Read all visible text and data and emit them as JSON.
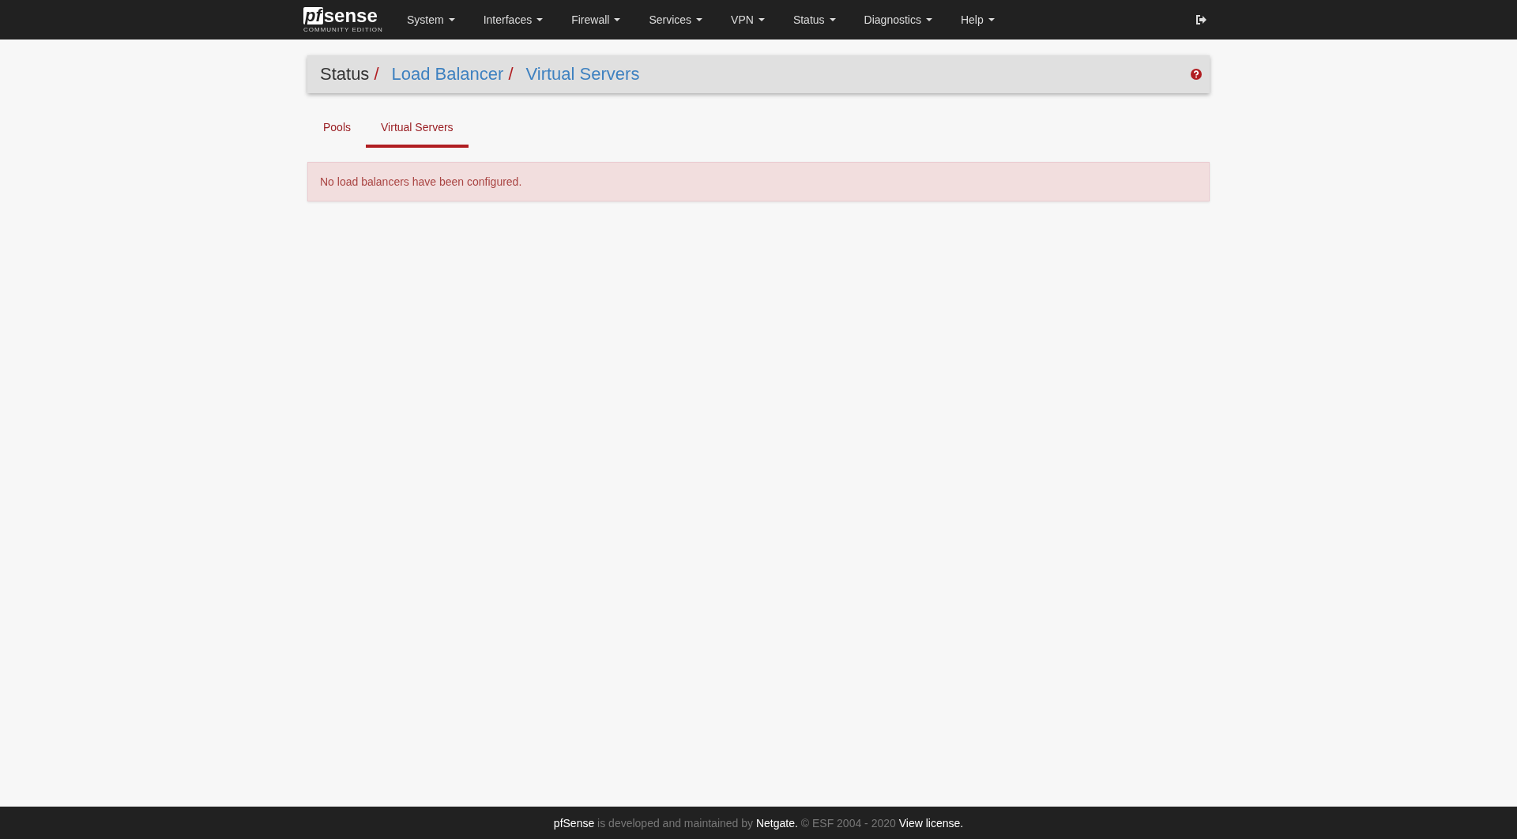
{
  "navbar": {
    "logo": {
      "mark": "pf",
      "word": "sense",
      "subtitle": "COMMUNITY EDITION"
    },
    "menus": [
      {
        "label": "System"
      },
      {
        "label": "Interfaces"
      },
      {
        "label": "Firewall"
      },
      {
        "label": "Services"
      },
      {
        "label": "VPN"
      },
      {
        "label": "Status"
      },
      {
        "label": "Diagnostics"
      },
      {
        "label": "Help"
      }
    ]
  },
  "breadcrumb": [
    {
      "label": "Status",
      "kind": "plain",
      "separator": "/"
    },
    {
      "label": "Load Balancer",
      "kind": "link",
      "separator": "/"
    },
    {
      "label": "Virtual Servers",
      "kind": "link"
    }
  ],
  "tabs": [
    {
      "label": "Pools",
      "selected": false
    },
    {
      "label": "Virtual Servers",
      "selected": true
    }
  ],
  "alert": {
    "text": "No load balancers have been configured."
  },
  "footer": [
    {
      "text": "pfSense",
      "kind": "link"
    },
    {
      "text": "is developed and maintained by",
      "kind": "text"
    },
    {
      "text": "Netgate.",
      "kind": "link"
    },
    {
      "text": "© ESF 2004 - 2020",
      "kind": "text"
    },
    {
      "text": "View license.",
      "kind": "link"
    }
  ]
}
